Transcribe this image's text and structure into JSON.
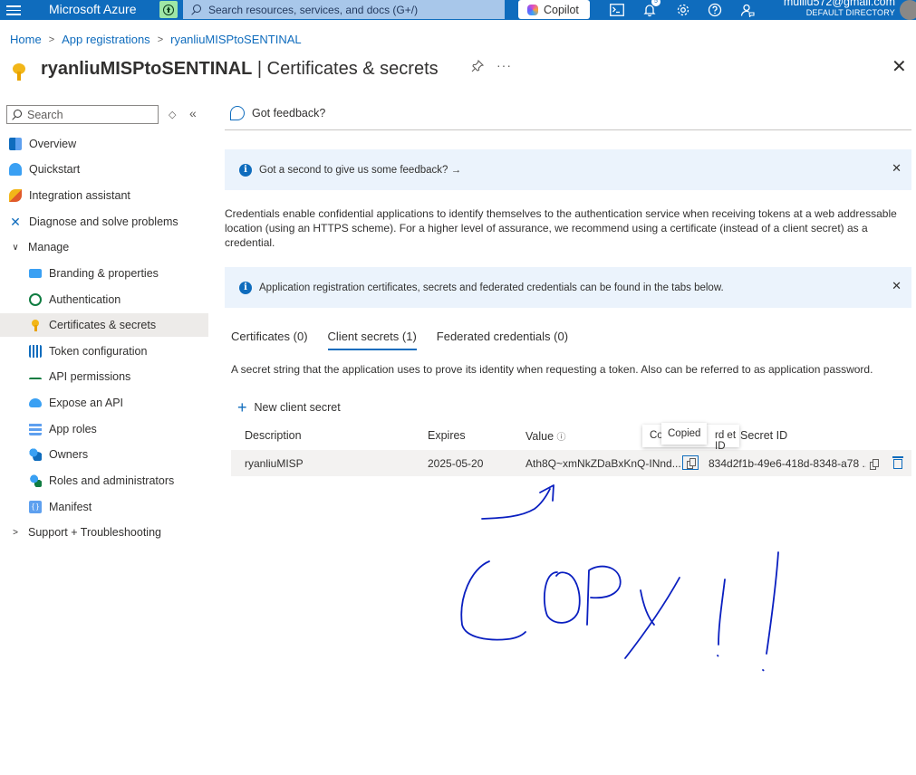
{
  "topbar": {
    "brand": "Microsoft Azure",
    "search_placeholder": "Search resources, services, and docs (G+/)",
    "copilot_label": "Copilot",
    "notifications_count": "5",
    "user_email": "muiliu572@gmail.com",
    "user_directory": "DEFAULT DIRECTORY",
    "accent_color": "#0f6cbd"
  },
  "breadcrumb": {
    "items": [
      "Home",
      "App registrations",
      "ryanliuMISPtoSENTINAL"
    ]
  },
  "page": {
    "title_app": "ryanliuMISPtoSENTINAL",
    "title_section": "| Certificates & secrets"
  },
  "sidebar": {
    "search_placeholder": "Search",
    "items": [
      {
        "label": "Overview",
        "icon": "overview-grid-icon"
      },
      {
        "label": "Quickstart",
        "icon": "quickstart-cloud-icon"
      },
      {
        "label": "Integration assistant",
        "icon": "rocket-icon"
      },
      {
        "label": "Diagnose and solve problems",
        "icon": "wrench-icon"
      },
      {
        "label": "Manage",
        "icon": "chevron-down-icon"
      },
      {
        "label": "Branding & properties",
        "icon": "branding-icon"
      },
      {
        "label": "Authentication",
        "icon": "authentication-icon"
      },
      {
        "label": "Certificates & secrets",
        "icon": "key-icon"
      },
      {
        "label": "Token configuration",
        "icon": "token-bars-icon"
      },
      {
        "label": "API permissions",
        "icon": "api-permissions-icon"
      },
      {
        "label": "Expose an API",
        "icon": "cloud-icon"
      },
      {
        "label": "App roles",
        "icon": "app-roles-grid-icon"
      },
      {
        "label": "Owners",
        "icon": "owners-icon"
      },
      {
        "label": "Roles and administrators",
        "icon": "roles-icon"
      },
      {
        "label": "Manifest",
        "icon": "manifest-icon"
      },
      {
        "label": "Support + Troubleshooting",
        "icon": "chevron-right-icon"
      }
    ]
  },
  "main": {
    "feedback_label": "Got feedback?",
    "banner1_text": "Got a second to give us some feedback? →",
    "description": "Credentials enable confidential applications to identify themselves to the authentication service when receiving tokens at a web addressable location (using an HTTPS scheme). For a higher level of assurance, we recommend using a certificate (instead of a client secret) as a credential.",
    "banner2_text": "Application registration certificates, secrets and federated credentials can be found in the tabs below.",
    "tabs": [
      "Certificates (0)",
      "Client secrets (1)",
      "Federated credentials (0)"
    ],
    "active_tab": "Client secrets (1)",
    "secrets_description": "A secret string that the application uses to prove its identity when requesting a token. Also can be referred to as application password.",
    "new_secret_label": "New client secret",
    "table": {
      "headers": [
        "Description",
        "Expires",
        "Value",
        "Secret ID"
      ],
      "header_value_info": "ⓘ",
      "rows": [
        {
          "description": "ryanliuMISP",
          "expires": "2025-05-20",
          "value": "Ath8Q~xmNkZDaBxKnQ-INnd...",
          "secret_id": "834d2f1b-49e6-418d-8348-a78 ..."
        }
      ]
    },
    "tooltip": {
      "under_left": "Co",
      "copied": "Copied",
      "under_right": "rd  et ID"
    }
  },
  "annotation": {
    "handwritten_text": "COPY!!",
    "ink_color": "#0a1fc0"
  }
}
